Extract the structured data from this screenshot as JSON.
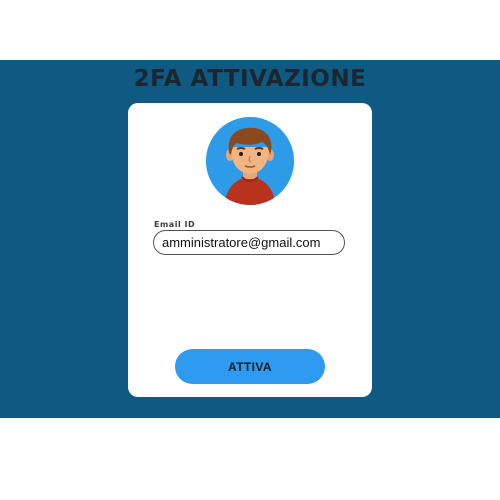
{
  "page": {
    "title": "2FA ATTIVAZIONE"
  },
  "form": {
    "avatar_icon": "user-avatar-icon",
    "email_label": "Email ID",
    "email_value": "amministratore@gmail.com",
    "submit_label": "ATTIVA"
  },
  "colors": {
    "band": "#0f5a82",
    "card": "#ffffff",
    "accent": "#2e9bf0",
    "title": "#1c2530"
  }
}
